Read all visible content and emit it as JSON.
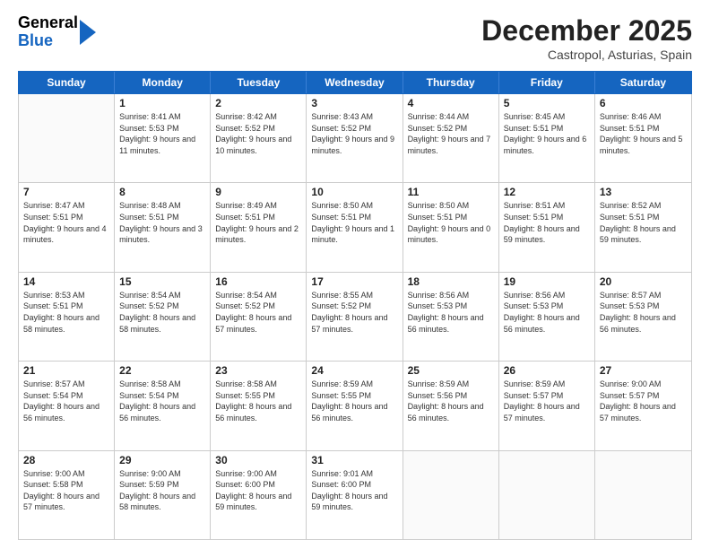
{
  "header": {
    "logo_general": "General",
    "logo_blue": "Blue",
    "month_title": "December 2025",
    "subtitle": "Castropol, Asturias, Spain"
  },
  "weekdays": [
    "Sunday",
    "Monday",
    "Tuesday",
    "Wednesday",
    "Thursday",
    "Friday",
    "Saturday"
  ],
  "weeks": [
    [
      {
        "day": "",
        "sunrise": "",
        "sunset": "",
        "daylight": ""
      },
      {
        "day": "1",
        "sunrise": "Sunrise: 8:41 AM",
        "sunset": "Sunset: 5:53 PM",
        "daylight": "Daylight: 9 hours and 11 minutes."
      },
      {
        "day": "2",
        "sunrise": "Sunrise: 8:42 AM",
        "sunset": "Sunset: 5:52 PM",
        "daylight": "Daylight: 9 hours and 10 minutes."
      },
      {
        "day": "3",
        "sunrise": "Sunrise: 8:43 AM",
        "sunset": "Sunset: 5:52 PM",
        "daylight": "Daylight: 9 hours and 9 minutes."
      },
      {
        "day": "4",
        "sunrise": "Sunrise: 8:44 AM",
        "sunset": "Sunset: 5:52 PM",
        "daylight": "Daylight: 9 hours and 7 minutes."
      },
      {
        "day": "5",
        "sunrise": "Sunrise: 8:45 AM",
        "sunset": "Sunset: 5:51 PM",
        "daylight": "Daylight: 9 hours and 6 minutes."
      },
      {
        "day": "6",
        "sunrise": "Sunrise: 8:46 AM",
        "sunset": "Sunset: 5:51 PM",
        "daylight": "Daylight: 9 hours and 5 minutes."
      }
    ],
    [
      {
        "day": "7",
        "sunrise": "Sunrise: 8:47 AM",
        "sunset": "Sunset: 5:51 PM",
        "daylight": "Daylight: 9 hours and 4 minutes."
      },
      {
        "day": "8",
        "sunrise": "Sunrise: 8:48 AM",
        "sunset": "Sunset: 5:51 PM",
        "daylight": "Daylight: 9 hours and 3 minutes."
      },
      {
        "day": "9",
        "sunrise": "Sunrise: 8:49 AM",
        "sunset": "Sunset: 5:51 PM",
        "daylight": "Daylight: 9 hours and 2 minutes."
      },
      {
        "day": "10",
        "sunrise": "Sunrise: 8:50 AM",
        "sunset": "Sunset: 5:51 PM",
        "daylight": "Daylight: 9 hours and 1 minute."
      },
      {
        "day": "11",
        "sunrise": "Sunrise: 8:50 AM",
        "sunset": "Sunset: 5:51 PM",
        "daylight": "Daylight: 9 hours and 0 minutes."
      },
      {
        "day": "12",
        "sunrise": "Sunrise: 8:51 AM",
        "sunset": "Sunset: 5:51 PM",
        "daylight": "Daylight: 8 hours and 59 minutes."
      },
      {
        "day": "13",
        "sunrise": "Sunrise: 8:52 AM",
        "sunset": "Sunset: 5:51 PM",
        "daylight": "Daylight: 8 hours and 59 minutes."
      }
    ],
    [
      {
        "day": "14",
        "sunrise": "Sunrise: 8:53 AM",
        "sunset": "Sunset: 5:51 PM",
        "daylight": "Daylight: 8 hours and 58 minutes."
      },
      {
        "day": "15",
        "sunrise": "Sunrise: 8:54 AM",
        "sunset": "Sunset: 5:52 PM",
        "daylight": "Daylight: 8 hours and 58 minutes."
      },
      {
        "day": "16",
        "sunrise": "Sunrise: 8:54 AM",
        "sunset": "Sunset: 5:52 PM",
        "daylight": "Daylight: 8 hours and 57 minutes."
      },
      {
        "day": "17",
        "sunrise": "Sunrise: 8:55 AM",
        "sunset": "Sunset: 5:52 PM",
        "daylight": "Daylight: 8 hours and 57 minutes."
      },
      {
        "day": "18",
        "sunrise": "Sunrise: 8:56 AM",
        "sunset": "Sunset: 5:53 PM",
        "daylight": "Daylight: 8 hours and 56 minutes."
      },
      {
        "day": "19",
        "sunrise": "Sunrise: 8:56 AM",
        "sunset": "Sunset: 5:53 PM",
        "daylight": "Daylight: 8 hours and 56 minutes."
      },
      {
        "day": "20",
        "sunrise": "Sunrise: 8:57 AM",
        "sunset": "Sunset: 5:53 PM",
        "daylight": "Daylight: 8 hours and 56 minutes."
      }
    ],
    [
      {
        "day": "21",
        "sunrise": "Sunrise: 8:57 AM",
        "sunset": "Sunset: 5:54 PM",
        "daylight": "Daylight: 8 hours and 56 minutes."
      },
      {
        "day": "22",
        "sunrise": "Sunrise: 8:58 AM",
        "sunset": "Sunset: 5:54 PM",
        "daylight": "Daylight: 8 hours and 56 minutes."
      },
      {
        "day": "23",
        "sunrise": "Sunrise: 8:58 AM",
        "sunset": "Sunset: 5:55 PM",
        "daylight": "Daylight: 8 hours and 56 minutes."
      },
      {
        "day": "24",
        "sunrise": "Sunrise: 8:59 AM",
        "sunset": "Sunset: 5:55 PM",
        "daylight": "Daylight: 8 hours and 56 minutes."
      },
      {
        "day": "25",
        "sunrise": "Sunrise: 8:59 AM",
        "sunset": "Sunset: 5:56 PM",
        "daylight": "Daylight: 8 hours and 56 minutes."
      },
      {
        "day": "26",
        "sunrise": "Sunrise: 8:59 AM",
        "sunset": "Sunset: 5:57 PM",
        "daylight": "Daylight: 8 hours and 57 minutes."
      },
      {
        "day": "27",
        "sunrise": "Sunrise: 9:00 AM",
        "sunset": "Sunset: 5:57 PM",
        "daylight": "Daylight: 8 hours and 57 minutes."
      }
    ],
    [
      {
        "day": "28",
        "sunrise": "Sunrise: 9:00 AM",
        "sunset": "Sunset: 5:58 PM",
        "daylight": "Daylight: 8 hours and 57 minutes."
      },
      {
        "day": "29",
        "sunrise": "Sunrise: 9:00 AM",
        "sunset": "Sunset: 5:59 PM",
        "daylight": "Daylight: 8 hours and 58 minutes."
      },
      {
        "day": "30",
        "sunrise": "Sunrise: 9:00 AM",
        "sunset": "Sunset: 6:00 PM",
        "daylight": "Daylight: 8 hours and 59 minutes."
      },
      {
        "day": "31",
        "sunrise": "Sunrise: 9:01 AM",
        "sunset": "Sunset: 6:00 PM",
        "daylight": "Daylight: 8 hours and 59 minutes."
      },
      {
        "day": "",
        "sunrise": "",
        "sunset": "",
        "daylight": ""
      },
      {
        "day": "",
        "sunrise": "",
        "sunset": "",
        "daylight": ""
      },
      {
        "day": "",
        "sunrise": "",
        "sunset": "",
        "daylight": ""
      }
    ]
  ]
}
